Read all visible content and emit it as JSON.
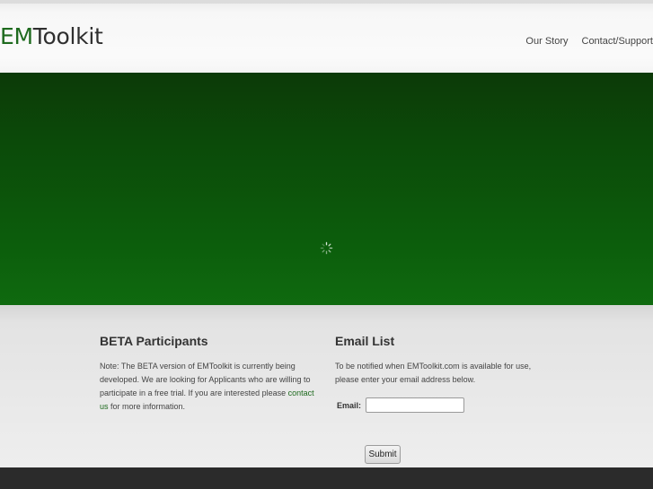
{
  "header": {
    "logo_em": "EM",
    "logo_rest": "Toolkit",
    "nav": {
      "our_story": "Our Story",
      "contact_support": "Contact/Support"
    }
  },
  "hero": {
    "spinner_icon": "loading-spinner"
  },
  "beta": {
    "title": "BETA Participants",
    "text_before_link": "Note: The BETA version of EMToolkit is currently being developed. We are looking for Applicants who are willing to participate in a free trial. If you are interested please ",
    "link_text": "contact us",
    "text_after_link": " for more information."
  },
  "email_list": {
    "title": "Email List",
    "text": "To be notified when EMToolkit.com is available for use, please enter your email address below.",
    "email_label": "Email:",
    "email_value": "",
    "submit_label": "Submit"
  },
  "colors": {
    "brand_green": "#1e6a1e",
    "hero_dark": "#0c3a08",
    "hero_light": "#0f6a0f",
    "footer": "#2b2b2b"
  }
}
